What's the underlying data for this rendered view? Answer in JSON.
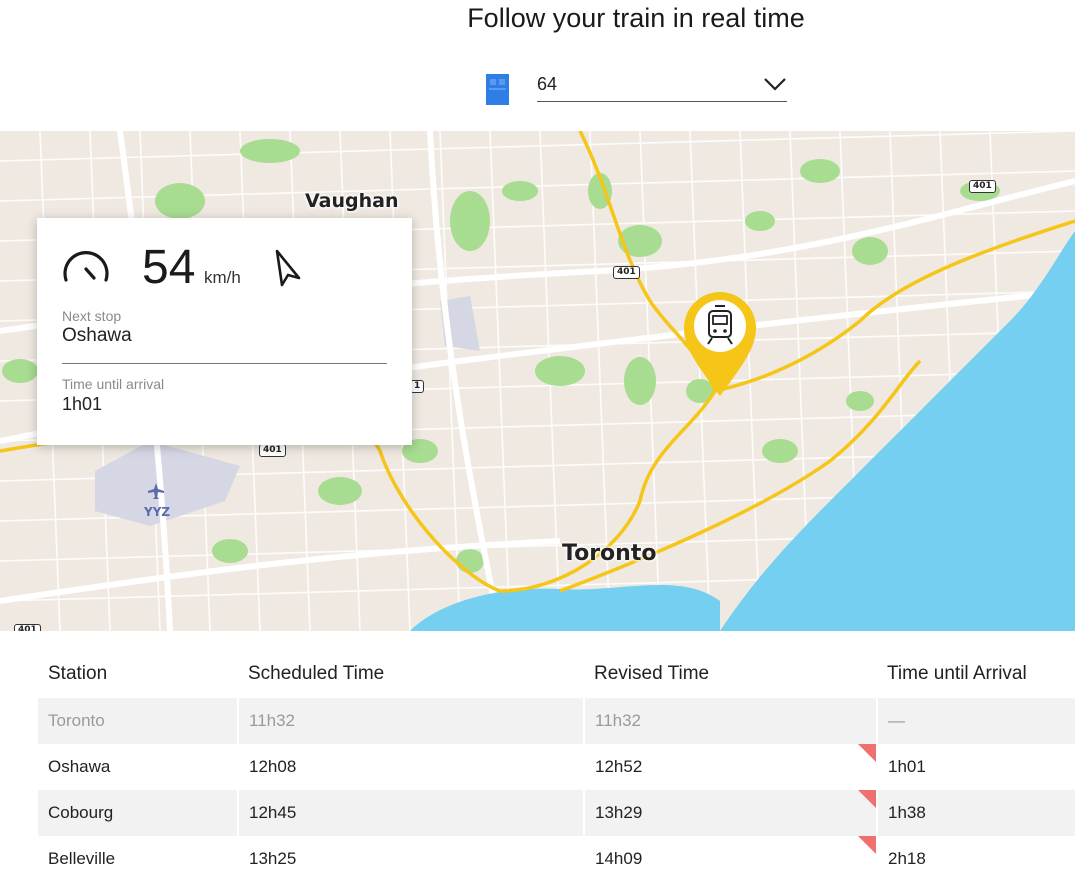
{
  "header": {
    "title": "Follow your train in real time"
  },
  "train_selector": {
    "value": "64",
    "icon": "train-icon"
  },
  "map": {
    "labels": {
      "vaughan": "Vaughan",
      "toronto": "Toronto",
      "airport": "YYZ"
    },
    "shields": [
      "401",
      "401",
      "401",
      "401",
      "1",
      "401"
    ],
    "colors": {
      "water": "#75cff0",
      "land": "#efe9e1",
      "park": "#a7dc91",
      "rail": "#f5c518",
      "pin": "#f5c518"
    }
  },
  "info_card": {
    "speed": "54",
    "speed_unit": "km/h",
    "next_stop_label": "Next stop",
    "next_stop_value": "Oshawa",
    "time_label": "Time until arrival",
    "time_value": "1h01"
  },
  "table": {
    "headers": [
      "Station",
      "Scheduled Time",
      "Revised Time",
      "Time until Arrival"
    ],
    "rows": [
      [
        "Toronto",
        "11h32",
        "11h32",
        "—"
      ],
      [
        "Oshawa",
        "12h08",
        "12h52",
        "1h01"
      ],
      [
        "Cobourg",
        "12h45",
        "13h29",
        "1h38"
      ],
      [
        "Belleville",
        "13h25",
        "14h09",
        "2h18"
      ]
    ],
    "delay_color": "#f07070"
  }
}
